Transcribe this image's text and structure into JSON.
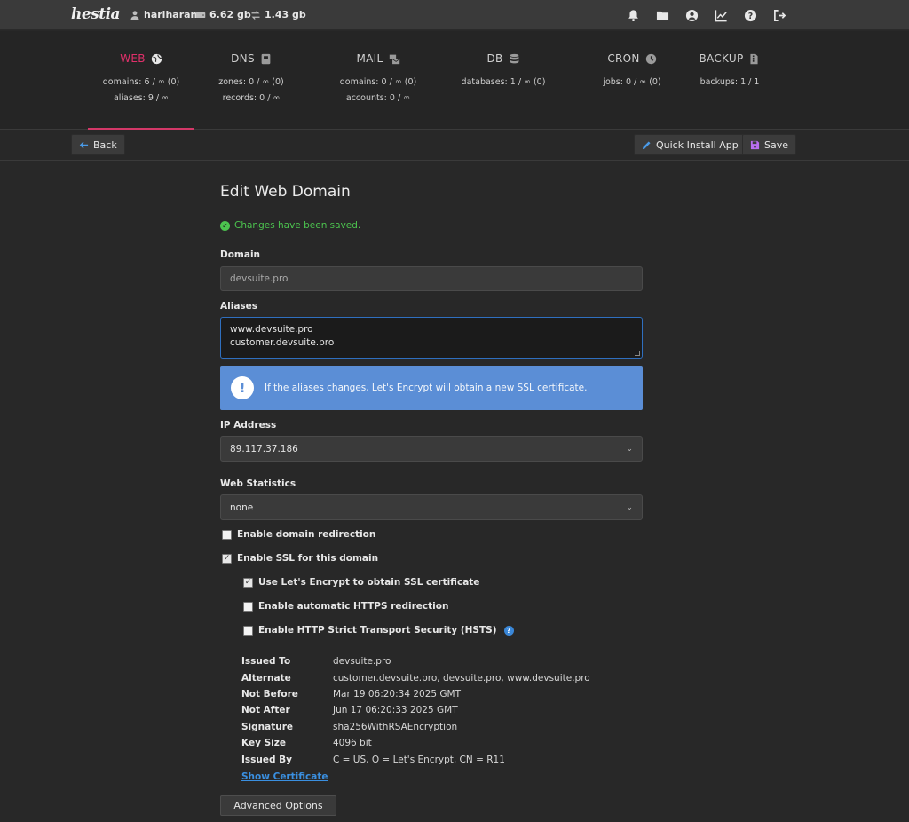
{
  "topbar": {
    "logo": "hestia",
    "user": "hariharan",
    "disk": "6.62 gb",
    "bandwidth": "1.43 gb",
    "icons": [
      "bell-icon",
      "folder-icon",
      "user-circle-icon",
      "chart-line-icon",
      "help-icon",
      "logout-icon"
    ]
  },
  "tabs": [
    {
      "label": "WEB",
      "icon": "globe-icon",
      "line1": "domains: 6 / ∞ (0)",
      "line2": "aliases: 9 / ∞",
      "active": true
    },
    {
      "label": "DNS",
      "icon": "dns-book-icon",
      "line1": "zones: 0 / ∞ (0)",
      "line2": "records: 0 / ∞"
    },
    {
      "label": "MAIL",
      "icon": "mail-bulk-icon",
      "line1": "domains: 0 / ∞ (0)",
      "line2": "accounts: 0 / ∞"
    },
    {
      "label": "DB",
      "icon": "database-icon",
      "line1": "databases: 1 / ∞ (0)",
      "line2": ""
    },
    {
      "label": "CRON",
      "icon": "clock-icon",
      "line1": "jobs: 0 / ∞ (0)",
      "line2": ""
    },
    {
      "label": "BACKUP",
      "icon": "file-archive-icon",
      "line1": "backups: 1 / 1",
      "line2": ""
    }
  ],
  "toolbar": {
    "back_label": "Back",
    "quick_install_label": "Quick Install App",
    "save_label": "Save"
  },
  "page": {
    "title": "Edit Web Domain",
    "success": "Changes have been saved."
  },
  "form": {
    "domain_label": "Domain",
    "domain_value": "devsuite.pro",
    "aliases_label": "Aliases",
    "aliases_line1": "www.devsuite.pro",
    "aliases_line2": "customer.devsuite.pro",
    "alert_text": "If the aliases changes, Let's Encrypt will obtain a new SSL certificate.",
    "ip_label": "IP Address",
    "ip_value": "89.117.37.186",
    "stats_label": "Web Statistics",
    "stats_value": "none",
    "redirect_label": "Enable domain redirection",
    "redirect_checked": false,
    "ssl_label": "Enable SSL for this domain",
    "ssl_checked": true,
    "letsencrypt_label": "Use Let's Encrypt to obtain SSL certificate",
    "letsencrypt_checked": true,
    "https_redirect_label": "Enable automatic HTTPS redirection",
    "https_redirect_checked": false,
    "hsts_label": "Enable HTTP Strict Transport Security (HSTS)",
    "hsts_checked": false
  },
  "certificate": [
    {
      "key": "Issued To",
      "value": "devsuite.pro"
    },
    {
      "key": "Alternate",
      "value": "customer.devsuite.pro, devsuite.pro, www.devsuite.pro"
    },
    {
      "key": "Not Before",
      "value": "Mar 19 06:20:34 2025 GMT"
    },
    {
      "key": "Not After",
      "value": "Jun 17 06:20:33 2025 GMT"
    },
    {
      "key": "Signature",
      "value": "sha256WithRSAEncryption"
    },
    {
      "key": "Key Size",
      "value": "4096 bit"
    },
    {
      "key": "Issued By",
      "value": "C = US, O = Let's Encrypt, CN = R11"
    }
  ],
  "show_certificate_label": "Show Certificate",
  "advanced_label": "Advanced Options",
  "colors": {
    "accent": "#d33868",
    "success": "#4cc44f",
    "info": "#5b8ed6",
    "link": "#3a8fe0"
  }
}
